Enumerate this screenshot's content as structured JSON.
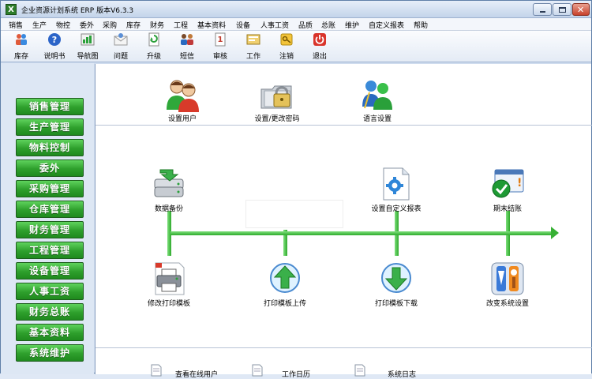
{
  "window": {
    "title": "企业资源计划系统 ERP 版本V6.3.3"
  },
  "menu": [
    "销售",
    "生产",
    "物控",
    "委外",
    "采购",
    "库存",
    "财务",
    "工程",
    "基本资料",
    "设备",
    "人事工资",
    "品质",
    "总账",
    "维护",
    "自定义报表",
    "帮助"
  ],
  "toolbar": [
    {
      "label": "库存",
      "icon": "people-inventory-icon"
    },
    {
      "label": "说明书",
      "icon": "help-icon"
    },
    {
      "label": "导航图",
      "icon": "navigation-map-icon"
    },
    {
      "label": "问题",
      "icon": "question-mail-icon"
    },
    {
      "label": "升级",
      "icon": "upgrade-icon"
    },
    {
      "label": "短信",
      "icon": "sms-users-icon"
    },
    {
      "label": "审核",
      "icon": "audit-icon"
    },
    {
      "label": "工作",
      "icon": "work-icon"
    },
    {
      "label": "注销",
      "icon": "logout-key-icon"
    },
    {
      "label": "退出",
      "icon": "exit-icon"
    }
  ],
  "sidebar": [
    "销售管理",
    "生产管理",
    "物料控制",
    "委外",
    "采购管理",
    "仓库管理",
    "财务管理",
    "工程管理",
    "设备管理",
    "人事工资",
    "财务总账",
    "基本资料",
    "系统维护"
  ],
  "top_items": [
    {
      "label": "设置用户",
      "icon": "users-icon"
    },
    {
      "label": "设置/更改密码",
      "icon": "password-lock-icon"
    },
    {
      "label": "语言设置",
      "icon": "language-users-icon"
    }
  ],
  "flow_upper": [
    {
      "label": "数据备份",
      "icon": "data-backup-icon"
    },
    {
      "label": "设置自定义报表",
      "icon": "custom-report-gear-icon"
    },
    {
      "label": "期末结账",
      "icon": "period-close-check-icon"
    }
  ],
  "flow_lower": [
    {
      "label": "修改打印模板",
      "icon": "printer-icon"
    },
    {
      "label": "打印模板上传",
      "icon": "upload-arrow-icon"
    },
    {
      "label": "打印模板下载",
      "icon": "download-arrow-icon"
    },
    {
      "label": "改变系统设置",
      "icon": "system-settings-tools-icon"
    }
  ],
  "bottom_items": [
    {
      "label": "查看在线用户",
      "icon": "document-icon"
    },
    {
      "label": "工作日历",
      "icon": "document-icon"
    },
    {
      "label": "系统日志",
      "icon": "document-icon"
    }
  ]
}
